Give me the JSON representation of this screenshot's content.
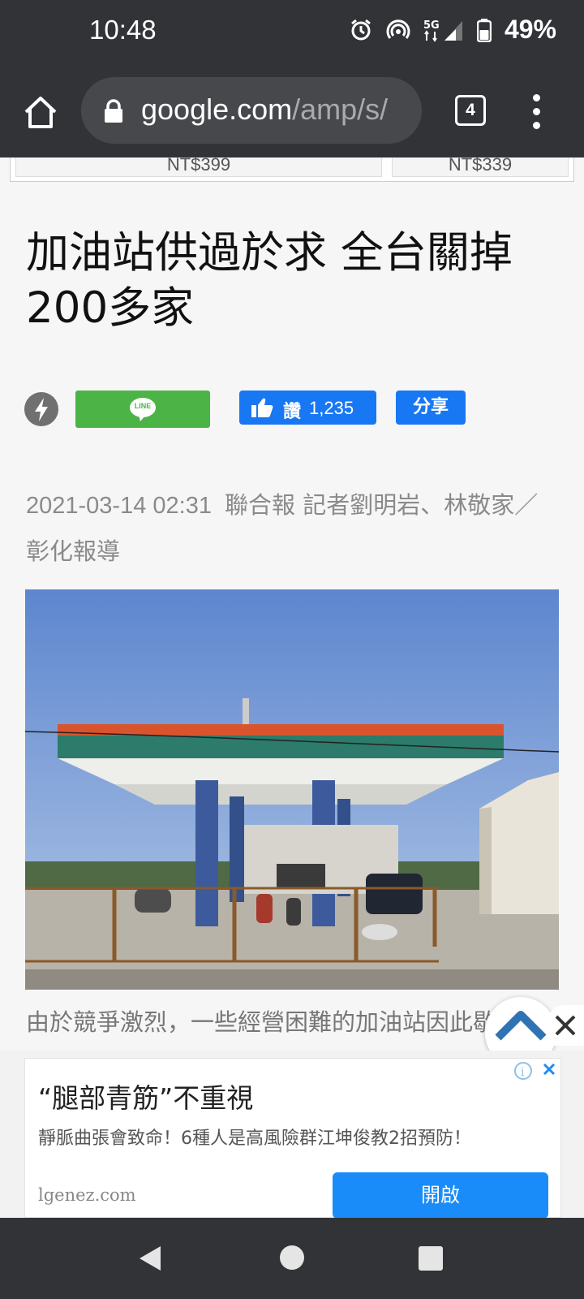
{
  "status_bar": {
    "time": "10:48",
    "battery": "49%"
  },
  "browser": {
    "url_host": "google.com",
    "url_path": "/amp/s/",
    "tab_count": "4"
  },
  "top_ad": {
    "price_left": "NT$399",
    "price_right": "NT$339"
  },
  "article": {
    "headline": "加油站供過於求 全台關掉200多家",
    "share": {
      "line_label": "LINE",
      "like_label": "讚",
      "like_count": "1,235",
      "share_label": "分享"
    },
    "date": "2021-03-14 02:31",
    "byline": "聯合報 記者劉明岩、林敬家／彰化報導",
    "paragraph_start": "由於競爭激烈，一些經營困難的加油站因此歇"
  },
  "ad": {
    "title": "“腿部青筋”不重視",
    "description": "靜脈曲張會致命！6種人是高風險群江坤俊教2招預防！",
    "domain": "lgenez.com",
    "cta": "開啟"
  },
  "colors": {
    "chrome_bg": "#323337",
    "line_green": "#4cb446",
    "facebook_blue": "#1877f2",
    "ad_button": "#1a8cf9"
  }
}
